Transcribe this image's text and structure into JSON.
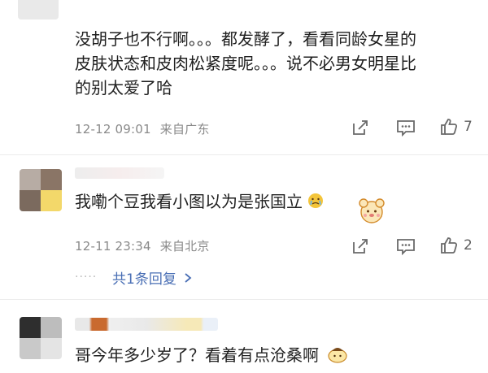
{
  "comments": [
    {
      "text_lines": [
        "没胡子也不行啊。。。都发酵了，看看同龄女星的",
        "皮肤状态和皮肉松紧度呢。。。说不必男女明星比",
        "的别太爱了哈"
      ],
      "time": "12-12 09:01",
      "location": "来自广东",
      "like_count": "7",
      "icons": {
        "share": "share-icon",
        "comment": "comment-icon",
        "like": "like-icon"
      }
    },
    {
      "text": "我嘞个豆我看小图以为是张国立",
      "time": "12-11 23:34",
      "location": "来自北京",
      "like_count": "2",
      "reply_more": "共1条回复",
      "reply_dots": "·····",
      "icons": {
        "share": "share-icon",
        "comment": "comment-icon",
        "like": "like-icon"
      }
    },
    {
      "text": "哥今年多少岁了？看着有点沧桑啊"
    }
  ],
  "colors": {
    "link": "#4a6fb5",
    "meta": "#8a8a8a",
    "divider": "#ececec"
  }
}
